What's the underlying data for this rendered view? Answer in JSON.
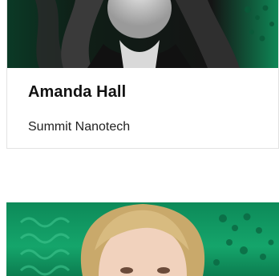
{
  "cards": [
    {
      "name": "Amanda Hall",
      "company": "Summit Nanotech"
    },
    {
      "name": "",
      "company": ""
    }
  ],
  "colors": {
    "brand_green": "#14a06a",
    "dark_green": "#0f2a1d",
    "card_border": "#e3e3e3"
  }
}
